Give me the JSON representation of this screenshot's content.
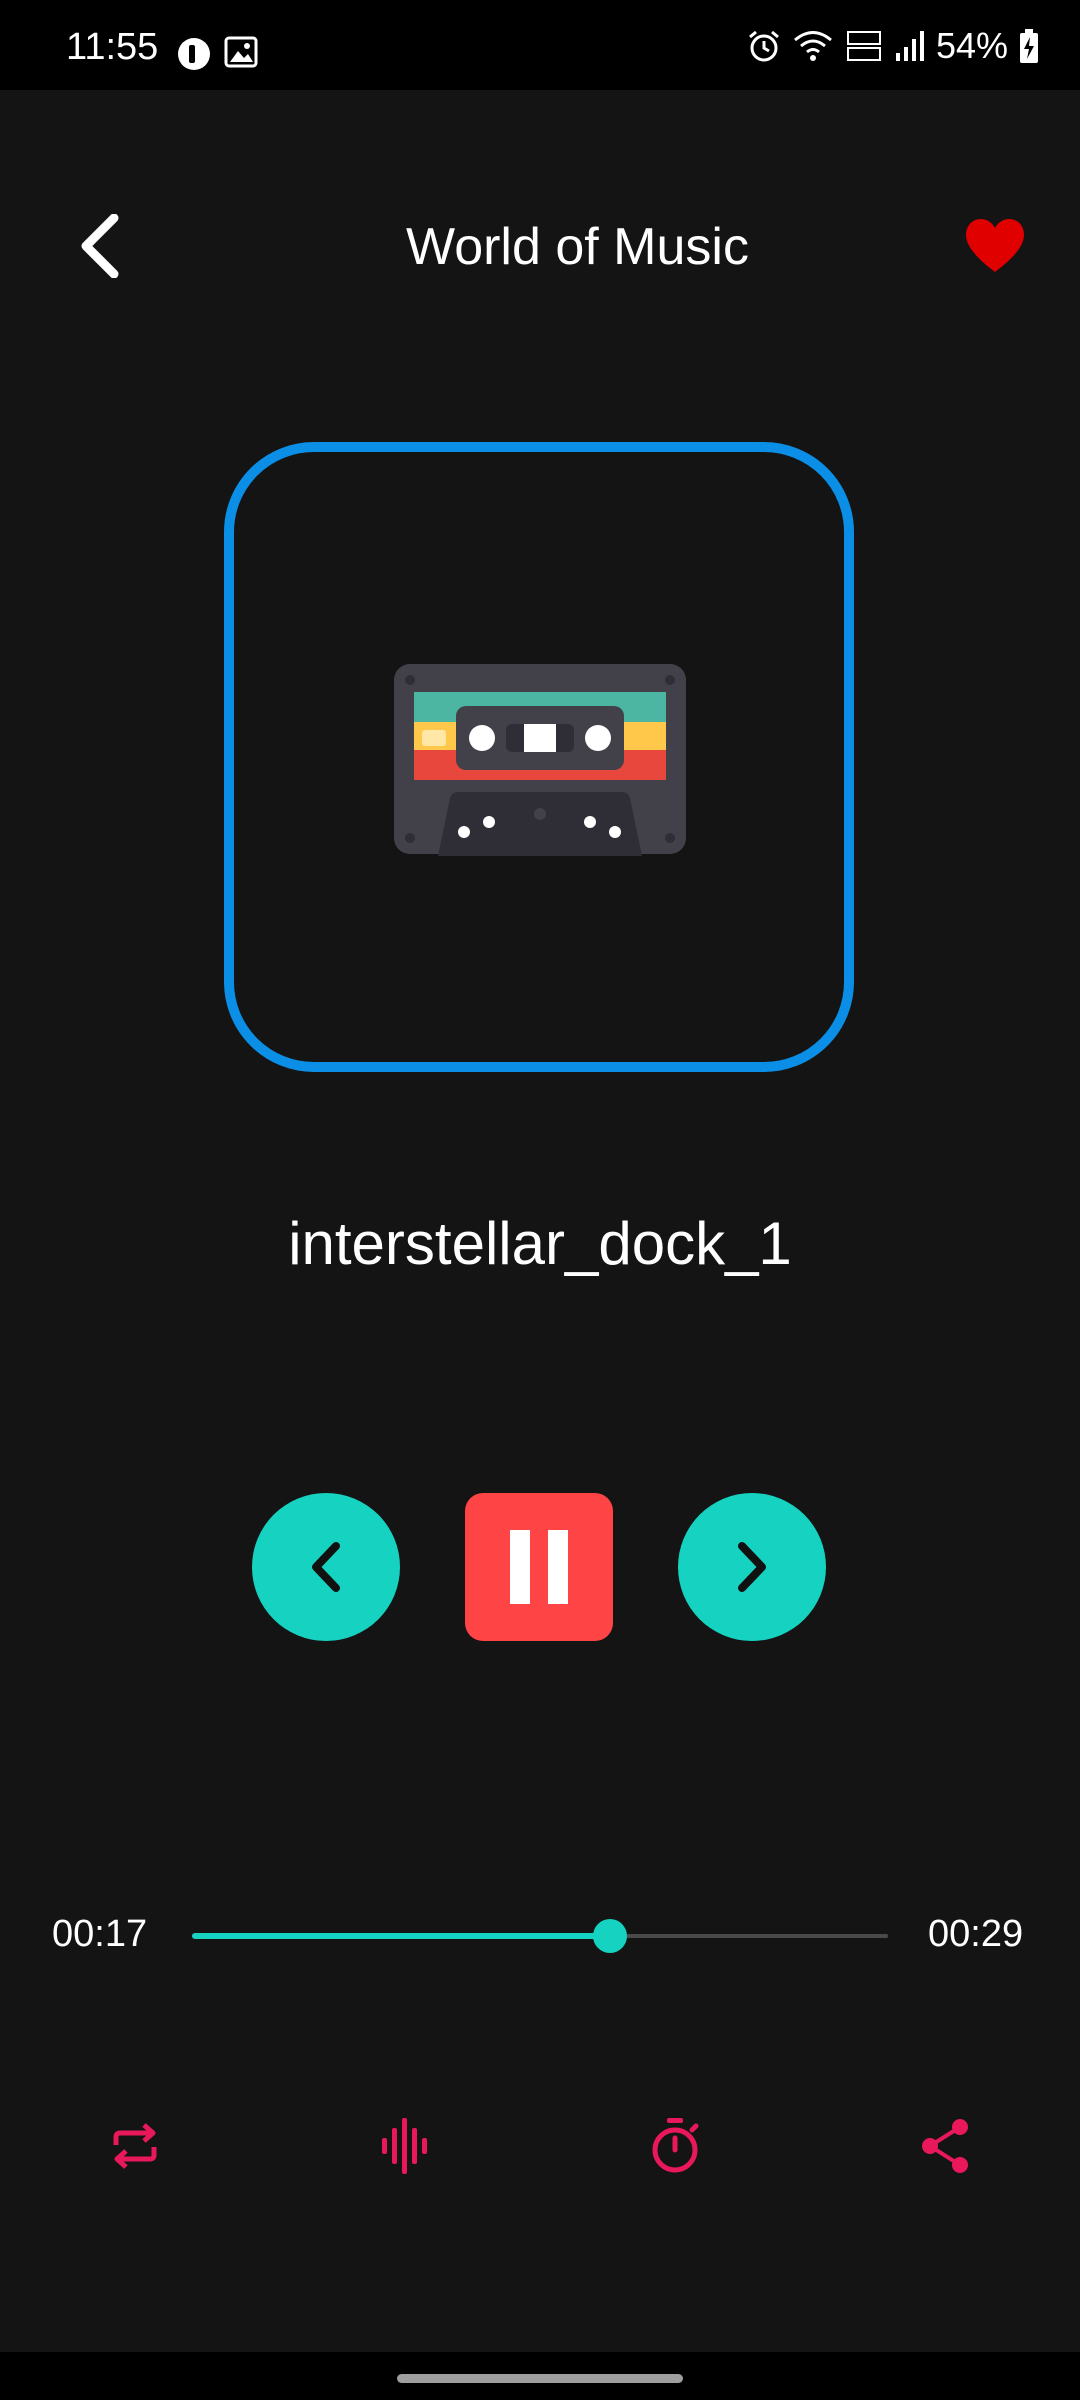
{
  "status_bar": {
    "time": "11:55",
    "battery": "54%",
    "icons": [
      "notification-app-icon",
      "gallery-icon",
      "alarm-icon",
      "wifi-icon",
      "volte-icon",
      "signal-icon",
      "battery-charging-icon"
    ]
  },
  "header": {
    "title": "World of Music",
    "back_icon": "chevron-left-icon",
    "favorite_icon": "heart-icon"
  },
  "artwork": {
    "icon": "cassette-icon"
  },
  "track": {
    "title": "interstellar_dock_1"
  },
  "controls": {
    "previous_icon": "chevron-left-icon",
    "pause_icon": "pause-icon",
    "next_icon": "chevron-right-icon"
  },
  "progress": {
    "current_time": "00:17",
    "total_time": "00:29",
    "fraction": 0.6
  },
  "bottom_actions": [
    "repeat-icon",
    "equalizer-icon",
    "timer-icon",
    "share-icon"
  ],
  "colors": {
    "background": "#141414",
    "accent_teal": "#15d3c0",
    "accent_red": "#ff4446",
    "accent_pink": "#e8185a",
    "frame_blue": "#0b8fe6",
    "favorite_red": "#e00000"
  }
}
